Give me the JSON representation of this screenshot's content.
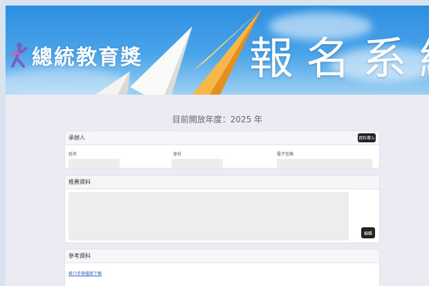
{
  "banner": {
    "brand": "總統教育獎",
    "title": "報名系統"
  },
  "year_line": "目前開放年度：2025 年",
  "recommender": {
    "heading": "承辦人",
    "action_button": "資料帶入",
    "fields": [
      {
        "label": "姓名",
        "value": ""
      },
      {
        "label": "身份",
        "value": ""
      },
      {
        "label": "電子信箱",
        "value": ""
      }
    ]
  },
  "recommend_info": {
    "heading": "推薦資料",
    "edit_button": "編輯"
  },
  "reference": {
    "heading": "參考資料",
    "link": "推介手冊檔案下載"
  },
  "colors": {
    "banner_blue": "#3a9ae6",
    "button_dark": "#222222",
    "link": "#3366cc",
    "page_bg": "#eceaf2"
  }
}
